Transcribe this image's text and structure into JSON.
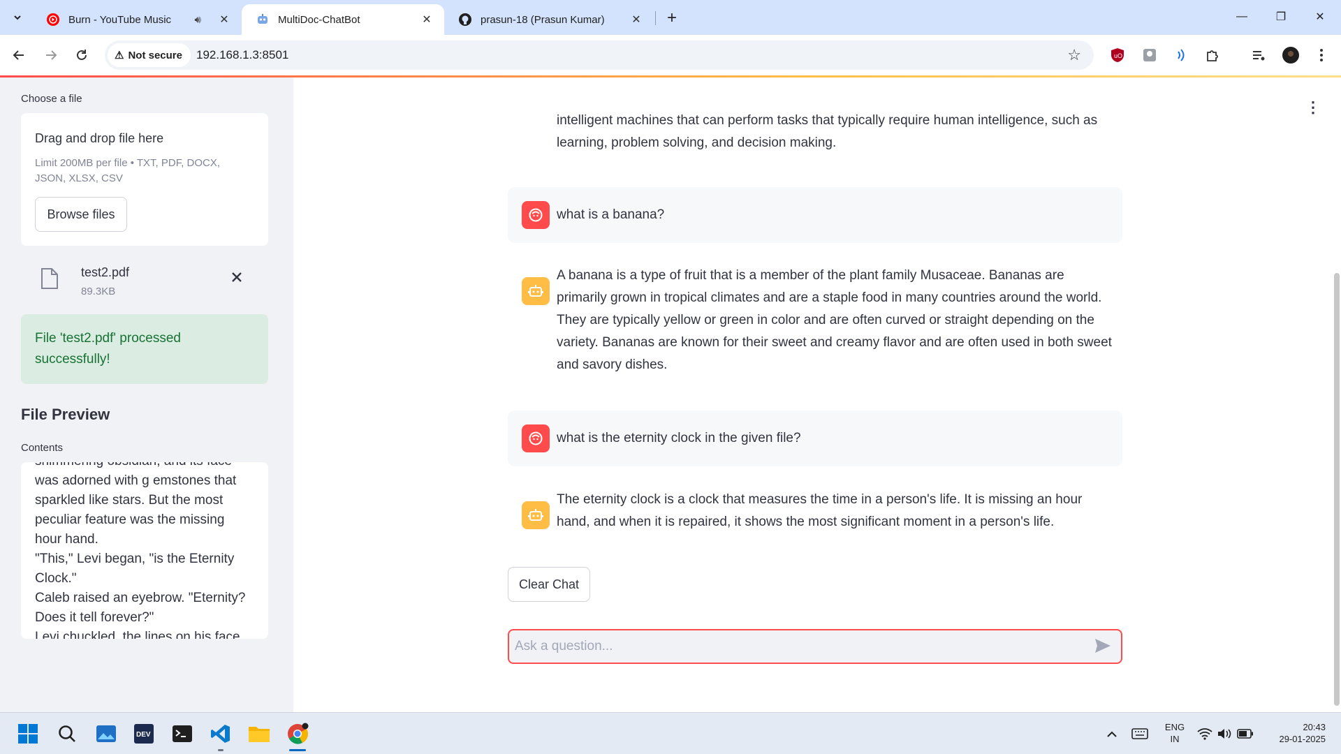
{
  "browser": {
    "tabs": [
      {
        "title": "Burn - YouTube Music",
        "active": false
      },
      {
        "title": "MultiDoc-ChatBot",
        "active": true
      },
      {
        "title": "prasun-18 (Prasun Kumar)",
        "active": false
      }
    ],
    "security_label": "Not secure",
    "url": "192.168.1.3:8501"
  },
  "sidebar": {
    "uploader_label": "Choose a file",
    "dropzone_title": "Drag and drop file here",
    "dropzone_limit": "Limit 200MB per file • TXT, PDF, DOCX, JSON, XLSX, CSV",
    "browse_label": "Browse files",
    "file": {
      "name": "test2.pdf",
      "size": "89.3KB"
    },
    "success_message": "File 'test2.pdf' processed successfully!",
    "preview_title": "File Preview",
    "contents_label": "Contents",
    "preview_text": "shimmering obsidian, and its face\nwas adorned with g emstones that\nsparkled like stars. But the most\npeculiar feature was the missing\nhour hand.\n\"This,\" Levi began, \"is the Eternity\nClock.\"\nCaleb raised an eyebrow. \"Eternity?\nDoes it tell forever?\"\nLevi chuckled, the lines on his face"
  },
  "chat": {
    "messages": [
      {
        "role": "assistant",
        "text": "intelligent machines that can perform tasks that typically require human intelligence, such as learning, problem solving, and decision making."
      },
      {
        "role": "user",
        "text": "what is a banana?"
      },
      {
        "role": "assistant",
        "text": "A banana is a type of fruit that is a member of the plant family Musaceae. Bananas are primarily grown in tropical climates and are a staple food in many countries around the world. They are typically yellow or green in color and are often curved or straight depending on the variety. Bananas are known for their sweet and creamy flavor and are often used in both sweet and savory dishes."
      },
      {
        "role": "user",
        "text": "what is the eternity clock in the given file?"
      },
      {
        "role": "assistant",
        "text": "The eternity clock is a clock that measures the time in a person's life. It is missing an hour hand, and when it is repaired, it shows the most significant moment in a person's life."
      }
    ],
    "clear_label": "Clear Chat",
    "input_placeholder": "Ask a question..."
  },
  "taskbar": {
    "language": "ENG",
    "region": "IN",
    "time": "20:43",
    "date": "29-01-2025"
  },
  "colors": {
    "accent": "#ff4b4b",
    "bot_avatar": "#ffbd45",
    "success_bg": "#dbede2",
    "success_text": "#177233",
    "tabstrip": "#d3e3fd"
  }
}
